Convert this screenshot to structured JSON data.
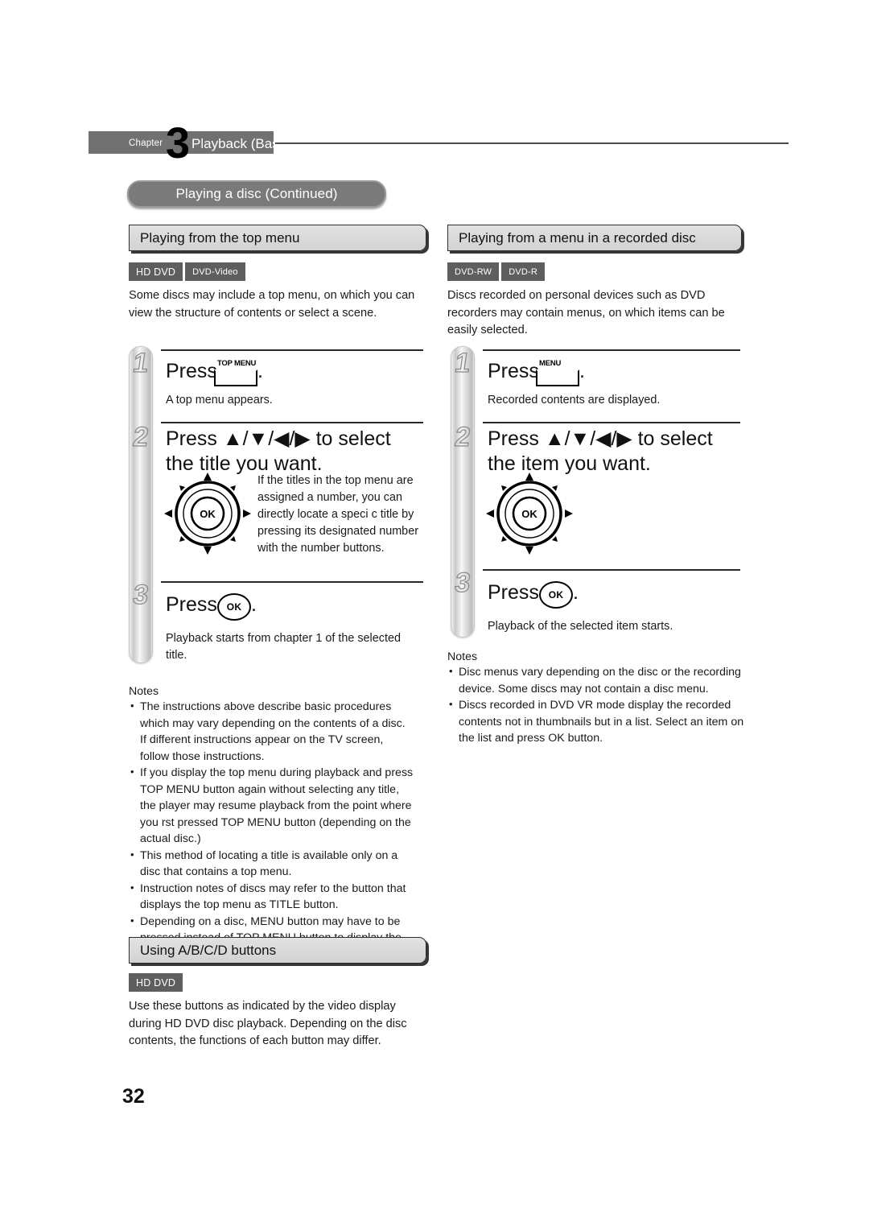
{
  "header": {
    "chapter_word": "Chapter",
    "chapter_number": "3",
    "chapter_title": "Playback (Basic)",
    "continued_banner": "Playing a disc (Continued)"
  },
  "left_column": {
    "section_title": "Playing from the top menu",
    "badges": [
      "HD DVD",
      "DVD-Video"
    ],
    "intro": "Some discs may include a top menu, on which you can view the structure of contents or select a scene.",
    "steps": [
      {
        "number": "1",
        "line_prefix": "Press",
        "button_caption": "TOP MENU",
        "button_type": "rect-key",
        "line_suffix": ".",
        "sub": "A top menu appears."
      },
      {
        "number": "2",
        "line": "Press ▲/▼/◀/▶ to select the title you want.",
        "diagram": "dpad-ok-wheel",
        "side_text": "If the titles in the top menu are assigned a number, you can directly locate a speci c title by pressing its designated number with the number buttons."
      },
      {
        "number": "3",
        "line_prefix": "Press",
        "button_caption": "OK",
        "button_type": "ok-round",
        "line_suffix": ".",
        "sub": "Playback starts from chapter 1 of the selected title."
      }
    ],
    "notes_title": "Notes",
    "notes": [
      "The instructions above describe basic procedures which may vary depending on the contents of a disc. If different instructions appear on the TV screen, follow those instructions.",
      "If you display the top menu during playback and press TOP MENU button again without selecting any title, the player may resume playback from the point where you  rst pressed TOP MENU button (depending on the actual disc.)",
      "This method of locating a title is available only on a disc that contains a top menu.",
      "Instruction notes of discs may refer to the button that displays the top menu as TITLE button.",
      "Depending on a disc, MENU button may have to be pressed instead of TOP MENU button to display the top menu."
    ]
  },
  "right_column": {
    "section_title": "Playing from a menu in a recorded disc",
    "badges": [
      "DVD-RW",
      "DVD-R"
    ],
    "intro": "Discs recorded on personal devices such as DVD recorders may contain menus, on which items can be easily selected.",
    "steps": [
      {
        "number": "1",
        "line_prefix": "Press",
        "button_caption": "MENU",
        "button_type": "rect-key",
        "line_suffix": ".",
        "sub": "Recorded contents are displayed."
      },
      {
        "number": "2",
        "line": "Press ▲/▼/◀/▶ to select the item you want.",
        "diagram": "dpad-ok-wheel"
      },
      {
        "number": "3",
        "line_prefix": "Press",
        "button_caption": "OK",
        "button_type": "ok-round",
        "line_suffix": ".",
        "sub": "Playback of the selected item starts."
      }
    ],
    "notes_title": "Notes",
    "notes": [
      "Disc menus vary depending on the disc or the recording device. Some discs may not contain a disc menu.",
      "Discs recorded in DVD VR mode display the recorded contents not in thumbnails but in a list. Select an item on the list and press OK button."
    ]
  },
  "bottom_section": {
    "section_title": "Using A/B/C/D buttons",
    "badges": [
      "HD DVD"
    ],
    "body": "Use these buttons as indicated by the video display during HD DVD disc playback. Depending on the disc contents, the functions of each button may differ."
  },
  "page_number": "32",
  "colors": {
    "band_gray": "#717171",
    "pill_gray": "#7a7a7a",
    "badge_gray": "#5e5e5e",
    "section_bar": "#d8d8d8",
    "rule_dark": "#2a2a2a",
    "text": "#1a1a1a"
  }
}
